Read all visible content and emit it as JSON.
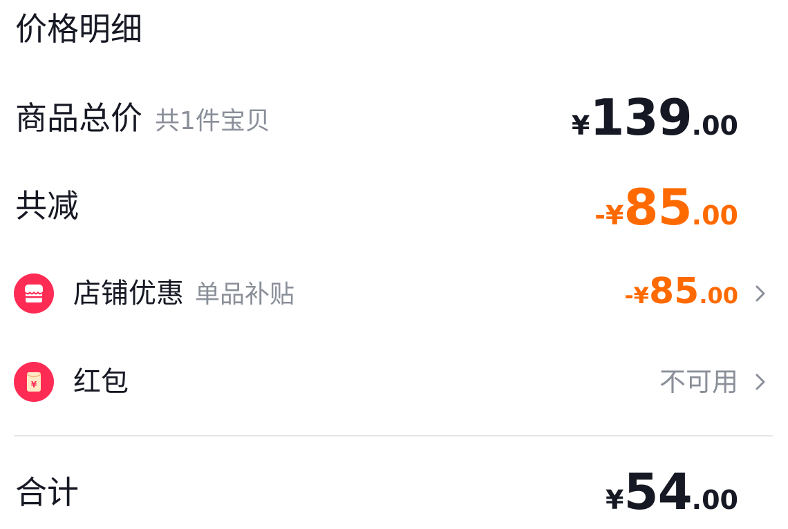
{
  "title": "价格明细",
  "goods_total": {
    "label": "商品总价",
    "sub": "共1件宝贝",
    "symbol": "¥",
    "integer": "139",
    "decimal": ".00"
  },
  "total_discount": {
    "label": "共减",
    "symbol": "-¥",
    "integer": "85",
    "decimal": ".00",
    "color": "#ff6a00"
  },
  "shop_discount": {
    "icon": "shop-icon",
    "label": "店铺优惠",
    "sub": "单品补贴",
    "symbol": "-¥",
    "integer": "85",
    "decimal": ".00"
  },
  "red_packet": {
    "icon": "red-packet-icon",
    "label": "红包",
    "status": "不可用"
  },
  "grand_total": {
    "label": "合计",
    "symbol": "¥",
    "integer": "54",
    "decimal": ".00"
  },
  "colors": {
    "text": "#161823",
    "muted": "#8a8f99",
    "accent": "#ff6a00",
    "icon_bg": "#fe2c55"
  }
}
